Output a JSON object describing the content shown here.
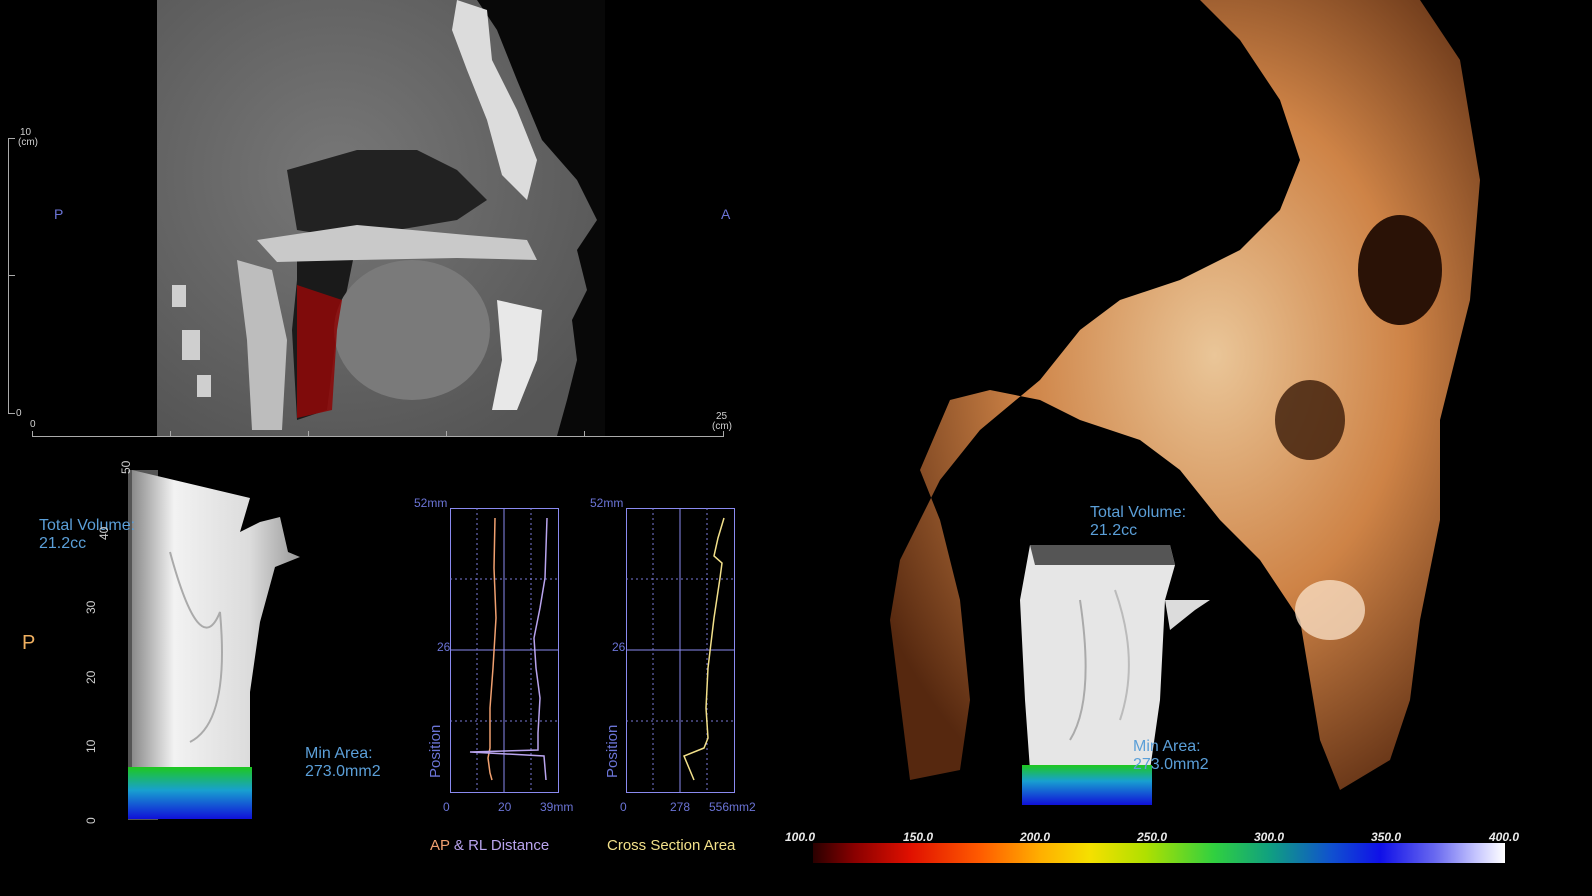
{
  "ct": {
    "posterior_label": "P",
    "anterior_label": "A",
    "vertical_ruler": {
      "top_value": "10",
      "top_unit": "(cm)",
      "bottom_value": "0"
    },
    "horizontal_ruler": {
      "left_value": "0",
      "right_value": "25",
      "right_unit": "(cm)"
    }
  },
  "airway_model_left": {
    "total_volume_label": "Total Volume:",
    "total_volume_value": "21.2cc",
    "min_area_label": "Min Area:",
    "min_area_value": "273.0mm2",
    "orientation_label": "P",
    "height_ticks": [
      "50",
      "40",
      "30",
      "20",
      "10",
      "0"
    ]
  },
  "charts": {
    "ap_rl": {
      "top_value": "52mm",
      "mid_value": "26",
      "y_axis_label": "Position",
      "x_ticks": [
        "0",
        "20",
        "39mm"
      ],
      "title_part1": "AP",
      "title_part2": " & RL Distance",
      "colors": {
        "ap": "#f0a070",
        "rl": "#b9a4ee",
        "frame": "#8a8af0",
        "grid": "#7a7ad8"
      }
    },
    "csa": {
      "top_value": "52mm",
      "mid_value": "26",
      "y_axis_label": "Position",
      "x_ticks": [
        "0",
        "278",
        "556mm2"
      ],
      "title": "Cross Section Area",
      "colors": {
        "area": "#f2e08a",
        "frame": "#8a8af0",
        "grid": "#7a7ad8"
      }
    }
  },
  "render_3d": {
    "total_volume_label": "Total Volume:",
    "total_volume_value": "21.2cc",
    "min_area_label": "Min Area:",
    "min_area_value": "273.0mm2"
  },
  "colorbar": {
    "labels": [
      "100.0",
      "150.0",
      "200.0",
      "250.0",
      "300.0",
      "350.0",
      "400.0"
    ]
  }
}
